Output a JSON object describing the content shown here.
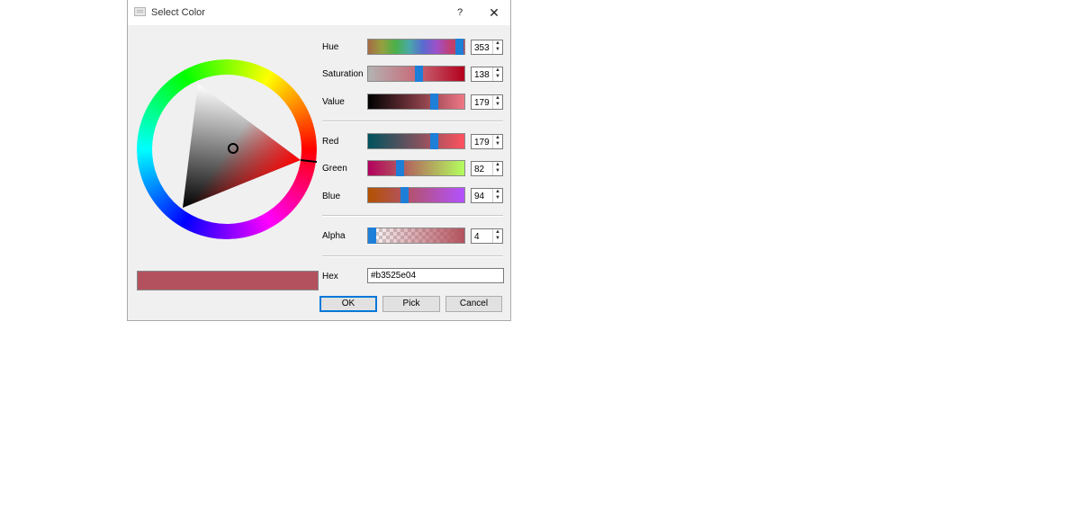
{
  "dialog": {
    "title": "Select Color",
    "help_label": "?",
    "close_label": "✕"
  },
  "hsv": {
    "hue": {
      "label": "Hue",
      "value": "353",
      "fraction": 0.94
    },
    "saturation": {
      "label": "Saturation",
      "value": "138",
      "fraction": 0.52
    },
    "value": {
      "label": "Value",
      "value": "179",
      "fraction": 0.68
    }
  },
  "rgb": {
    "red": {
      "label": "Red",
      "value": "179",
      "fraction": 0.68
    },
    "green": {
      "label": "Green",
      "value": "82",
      "fraction": 0.33
    },
    "blue": {
      "label": "Blue",
      "value": "94",
      "fraction": 0.37
    }
  },
  "alpha": {
    "label": "Alpha",
    "value": "4",
    "fraction": 0.02
  },
  "hex": {
    "label": "Hex",
    "value": "#b3525e04"
  },
  "preview_color": "#b3525e",
  "buttons": {
    "ok": "OK",
    "pick": "Pick",
    "cancel": "Cancel"
  }
}
